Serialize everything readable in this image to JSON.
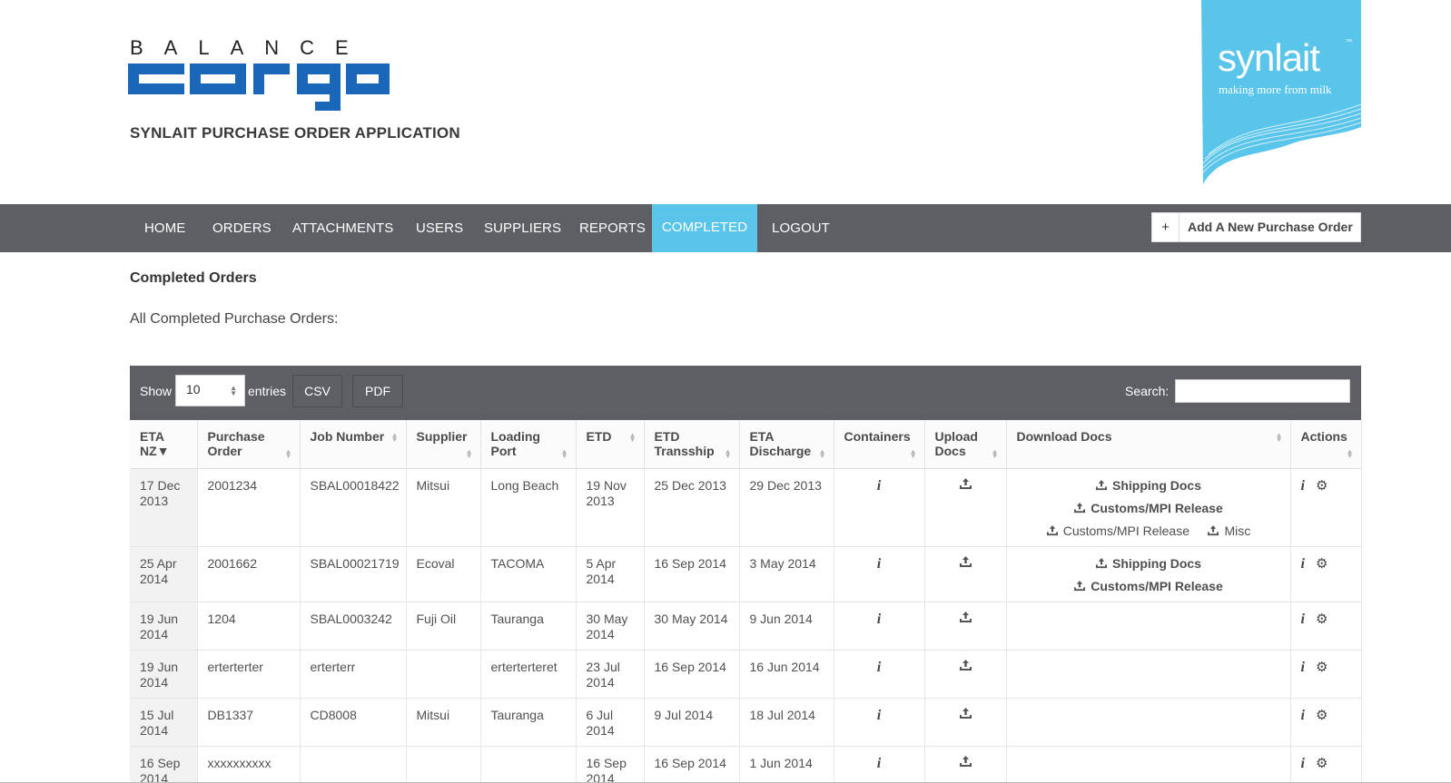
{
  "header": {
    "logo_top": "BALANCE",
    "logo_main": "cargo",
    "app_title": "SYNLAIT PURCHASE ORDER APPLICATION",
    "brand_name": "synlait",
    "brand_tm": "™",
    "brand_tagline": "making more from milk",
    "colors": {
      "logo_blue": "#1a66b8",
      "brand_blue": "#5ac5ea",
      "nav_bg": "#5d5f65"
    }
  },
  "nav": {
    "items": [
      "HOME",
      "ORDERS",
      "ATTACHMENTS",
      "USERS",
      "SUPPLIERS",
      "REPORTS",
      "COMPLETED",
      "LOGOUT"
    ],
    "active": "COMPLETED",
    "add_button_icon": "+",
    "add_button_label": "Add A New Purchase Order"
  },
  "page": {
    "title": "Completed Orders",
    "subtitle": "All Completed Purchase Orders:"
  },
  "toolbar": {
    "show_label": "Show",
    "entries_value": "10",
    "entries_label": "entries",
    "csv_label": "CSV",
    "pdf_label": "PDF",
    "search_label": "Search:",
    "search_value": ""
  },
  "table": {
    "headers": [
      [
        "ETA",
        "NZ▼"
      ],
      [
        "Purchase",
        "Order"
      ],
      [
        "Job Number"
      ],
      [
        "Supplier"
      ],
      [
        "Loading",
        "Port"
      ],
      [
        "ETD"
      ],
      [
        "ETD",
        "Transship"
      ],
      [
        "ETA",
        "Discharge"
      ],
      [
        "Containers"
      ],
      [
        "Upload",
        "Docs"
      ],
      [
        "Download Docs"
      ],
      [
        "Actions"
      ]
    ],
    "rows": [
      {
        "eta": [
          "17 Dec",
          "2013"
        ],
        "po": "2001234",
        "job": "SBAL00018422",
        "supplier": "Mitsui",
        "port": "Long Beach",
        "etd": [
          "19 Nov",
          "2013"
        ],
        "etd_transship": "25 Dec 2013",
        "eta_discharge": "29 Dec 2013",
        "docs": [
          [
            "Shipping Docs"
          ],
          [
            "Customs/MPI Release"
          ],
          [
            "Customs/MPI Release",
            "Misc"
          ]
        ]
      },
      {
        "eta": [
          "25 Apr",
          "2014"
        ],
        "po": "2001662",
        "job": "SBAL00021719",
        "supplier": "Ecoval",
        "port": "TACOMA",
        "etd": [
          "5 Apr",
          "2014"
        ],
        "etd_transship": "16 Sep 2014",
        "eta_discharge": "3 May 2014",
        "docs": [
          [
            "Shipping Docs"
          ],
          [
            "Customs/MPI Release"
          ]
        ]
      },
      {
        "eta": [
          "19 Jun",
          "2014"
        ],
        "po": "1204",
        "job": "SBAL0003242",
        "supplier": "Fuji Oil",
        "port": "Tauranga",
        "etd": [
          "30 May",
          "2014"
        ],
        "etd_transship": "30 May 2014",
        "eta_discharge": "9 Jun 2014",
        "docs": []
      },
      {
        "eta": [
          "19 Jun",
          "2014"
        ],
        "po": "erterterter",
        "job": "erterterr",
        "supplier": "",
        "port": "erterterteret",
        "etd": [
          "23 Jul",
          "2014"
        ],
        "etd_transship": "16 Sep 2014",
        "eta_discharge": "16 Jun 2014",
        "docs": []
      },
      {
        "eta": [
          "15 Jul",
          "2014"
        ],
        "po": "DB1337",
        "job": "CD8008",
        "supplier": "Mitsui",
        "port": "Tauranga",
        "etd": [
          "6 Jul",
          "2014"
        ],
        "etd_transship": "9 Jul 2014",
        "eta_discharge": "18 Jul 2014",
        "docs": []
      },
      {
        "eta": [
          "16 Sep",
          "2014"
        ],
        "po": "xxxxxxxxxx",
        "job": "",
        "supplier": "",
        "port": "",
        "etd": [
          "16 Sep",
          "2014"
        ],
        "etd_transship": "16 Sep 2014",
        "eta_discharge": "1 Jun 2014",
        "docs": []
      }
    ],
    "containers_icon": "i",
    "upload_icon": "upload-icon",
    "actions_info_icon": "i",
    "actions_settings_icon": "⚙"
  }
}
